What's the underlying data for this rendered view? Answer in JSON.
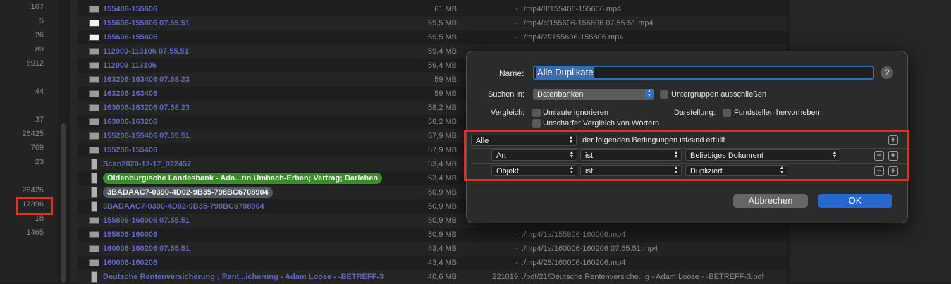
{
  "counts": [
    "167",
    "5",
    "26",
    "89",
    "6912",
    "44",
    "37",
    "26425",
    "769",
    "23",
    "26425",
    "17396",
    "18",
    "1465"
  ],
  "files": [
    {
      "name": "155406-155606",
      "size": "61 MB",
      "extra": "-",
      "path": "./mp4/8/155406-155606.mp4",
      "icon": "video",
      "style": ""
    },
    {
      "name": "155606-155806 07.55.51",
      "size": "59,5 MB",
      "extra": "-",
      "path": "./mp4/c/155606-155806 07.55.51.mp4",
      "icon": "white",
      "style": ""
    },
    {
      "name": "155606-155806",
      "size": "59,5 MB",
      "extra": "-",
      "path": "./mp4/2f/155606-155806.mp4",
      "icon": "white",
      "style": ""
    },
    {
      "name": "112909-113106 07.55.51",
      "size": "59,4 MB",
      "extra": "",
      "path": "",
      "icon": "video",
      "style": ""
    },
    {
      "name": "112909-113106",
      "size": "59,4 MB",
      "extra": "",
      "path": "",
      "icon": "video",
      "style": ""
    },
    {
      "name": "163206-163406 07.58.23",
      "size": "59 MB",
      "extra": "",
      "path": "",
      "icon": "video",
      "style": ""
    },
    {
      "name": "163206-163406",
      "size": "59 MB",
      "extra": "",
      "path": "",
      "icon": "video",
      "style": ""
    },
    {
      "name": "163006-163206 07.58.23",
      "size": "58,2 MB",
      "extra": "",
      "path": "",
      "icon": "video",
      "style": ""
    },
    {
      "name": "163006-163206",
      "size": "58,2 MB",
      "extra": "",
      "path": "",
      "icon": "video",
      "style": ""
    },
    {
      "name": "155206-155406 07.55.51",
      "size": "57,9 MB",
      "extra": "",
      "path": "",
      "icon": "video",
      "style": ""
    },
    {
      "name": "155206-155406",
      "size": "57,9 MB",
      "extra": "",
      "path": "",
      "icon": "video",
      "style": ""
    },
    {
      "name": "Scan2020-12-17_022457",
      "size": "53,4 MB",
      "extra": "",
      "path": "",
      "icon": "doc",
      "style": ""
    },
    {
      "name": "Oldenburgische Landesbank - Ada...rin Umbach-Erben; Vertrag; Darlehen",
      "size": "53,4 MB",
      "extra": "",
      "path": "",
      "icon": "doc",
      "style": "green"
    },
    {
      "name": "3BADAAC7-0390-4D02-9B35-798BC6708904",
      "size": "50,9 MB",
      "extra": "",
      "path": "",
      "icon": "doc",
      "style": "grey"
    },
    {
      "name": "3BADAAC7-0390-4D02-9B35-798BC6708904",
      "size": "50,9 MB",
      "extra": "",
      "path": "",
      "icon": "doc",
      "style": ""
    },
    {
      "name": "155806-160006 07.55.51",
      "size": "50,9 MB",
      "extra": "",
      "path": "",
      "icon": "video",
      "style": ""
    },
    {
      "name": "155806-160006",
      "size": "50,9 MB",
      "extra": "-",
      "path": "./mp4/1a/155806-160006.mp4",
      "icon": "video",
      "style": ""
    },
    {
      "name": "160006-160206 07.55.51",
      "size": "43,4 MB",
      "extra": "-",
      "path": "./mp4/1a/160006-160206 07.55.51.mp4",
      "icon": "video",
      "style": ""
    },
    {
      "name": "160006-160206",
      "size": "43,4 MB",
      "extra": "-",
      "path": "./mp4/28/160006-160206.mp4",
      "icon": "video",
      "style": ""
    },
    {
      "name": "Deutsche Rentenversicherung ; Rent...icherung - Adam Loose - -BETREFF-3",
      "size": "40,6 MB",
      "extra": "221019",
      "path": "./pdf/21/Deutsche Rentenversiche...g - Adam Loose - -BETREFF-3.pdf",
      "icon": "doc",
      "style": ""
    }
  ],
  "dialog": {
    "name_label": "Name:",
    "name_value": "Alle Duplikate",
    "help": "?",
    "search_in_label": "Suchen in:",
    "search_in_value": "Datenbanken",
    "exclude_subgroups": "Untergruppen ausschließen",
    "compare_label": "Vergleich:",
    "ignore_umlauts": "Umlaute ignorieren",
    "fuzzy_compare": "Unscharfer Vergleich von Wörtern",
    "display_label": "Darstellung:",
    "highlight_occurrences": "Fundstellen hervorheben",
    "match_mode": "Alle",
    "match_text": "der folgenden Bedingungen ist/sind erfüllt",
    "conditions": [
      {
        "field": "Art",
        "op": "ist",
        "value": "Beliebiges Dokument"
      },
      {
        "field": "Objekt",
        "op": "ist",
        "value": "Dupliziert"
      }
    ],
    "add": "+",
    "remove": "−",
    "cancel": "Abbrechen",
    "ok": "OK"
  },
  "colors": {
    "accent": "#2569d0",
    "highlight": "#e0301e",
    "link": "#6067b8",
    "tag_green": "#3d8a2e"
  }
}
